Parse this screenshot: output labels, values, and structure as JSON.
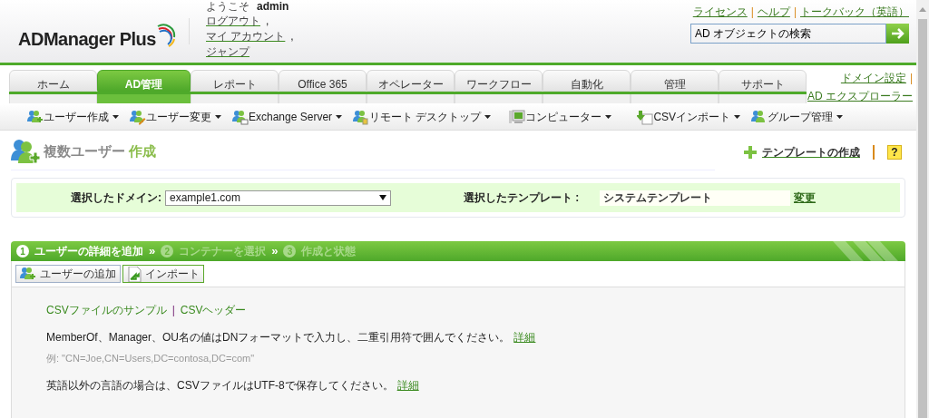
{
  "header": {
    "logo": "ADManager Plus",
    "welcome": {
      "label": "ようこそ",
      "user": "admin"
    },
    "user_links": [
      {
        "label": "ログアウト",
        "separator": ","
      },
      {
        "label": "マイ アカウント",
        "separator": ","
      },
      {
        "label": "ジャンプ"
      }
    ],
    "top_links": [
      {
        "label": "ライセンス",
        "separator": "|"
      },
      {
        "label": "ヘルプ",
        "separator": "|"
      },
      {
        "label": "トークバック（英語）"
      }
    ],
    "search": {
      "placeholder": "AD オブジェクトの検索"
    }
  },
  "tabs": [
    {
      "label": "ホーム",
      "selected": false
    },
    {
      "label": "AD管理",
      "selected": true
    },
    {
      "label": "レポート",
      "selected": false
    },
    {
      "label": "Office 365",
      "selected": false
    },
    {
      "label": "オペレーター",
      "selected": false
    },
    {
      "label": "ワークフロー",
      "selected": false
    },
    {
      "label": "自動化",
      "selected": false
    },
    {
      "label": "管理",
      "selected": false
    },
    {
      "label": "サポート",
      "selected": false
    }
  ],
  "side_links": [
    {
      "label": "ドメイン設定",
      "separator": "|"
    },
    {
      "label": "AD エクスプローラー"
    }
  ],
  "toolbar": [
    {
      "label": "ユーザー作成",
      "kind": "user-add"
    },
    {
      "label": "ユーザー変更",
      "kind": "user-edit"
    },
    {
      "label": "Exchange Server",
      "kind": "user-mail"
    },
    {
      "label": "リモート デスクトップ",
      "kind": "user-remote"
    },
    {
      "label": "コンピューター",
      "kind": "computer"
    },
    {
      "label": "CSVインポート",
      "kind": "csv"
    },
    {
      "label": "グループ管理",
      "kind": "group"
    }
  ],
  "page_title": {
    "text": "複数ユーザー",
    "accent": "作成"
  },
  "template_link": "テンプレートの作成",
  "help": "?",
  "domain": {
    "label": "選択したドメイン:",
    "value": "example1.com"
  },
  "template": {
    "label": "選択したテンプレート :",
    "value": "システムテンプレート",
    "action": "変更"
  },
  "steps": [
    {
      "number": "1",
      "label": "ユーザーの詳細を追加",
      "selected": true,
      "separator": "»"
    },
    {
      "number": "2",
      "label": "コンテナーを選択",
      "selected": false,
      "separator": "»"
    },
    {
      "number": "3",
      "label": "作成と状態",
      "selected": false
    }
  ],
  "actions": [
    {
      "label": "ユーザーの追加",
      "kind": "user-add",
      "selected": false
    },
    {
      "label": "インポート",
      "kind": "import",
      "selected": true
    }
  ],
  "content": {
    "links": [
      {
        "label": "CSVファイルのサンプル",
        "separator": "|"
      },
      {
        "label": "CSVヘッダー"
      }
    ],
    "notes": [
      {
        "text": "MemberOf、Manager、OU名の値はDNフォーマットで入力し、二重引用符で囲んでください。",
        "link": "詳細",
        "example": "例: \"CN=Joe,CN=Users,DC=contosa,DC=com\""
      },
      {
        "text": "英語以外の言語の場合は、CSVファイルはUTF-8で保存してください。",
        "link": "詳細"
      }
    ]
  }
}
